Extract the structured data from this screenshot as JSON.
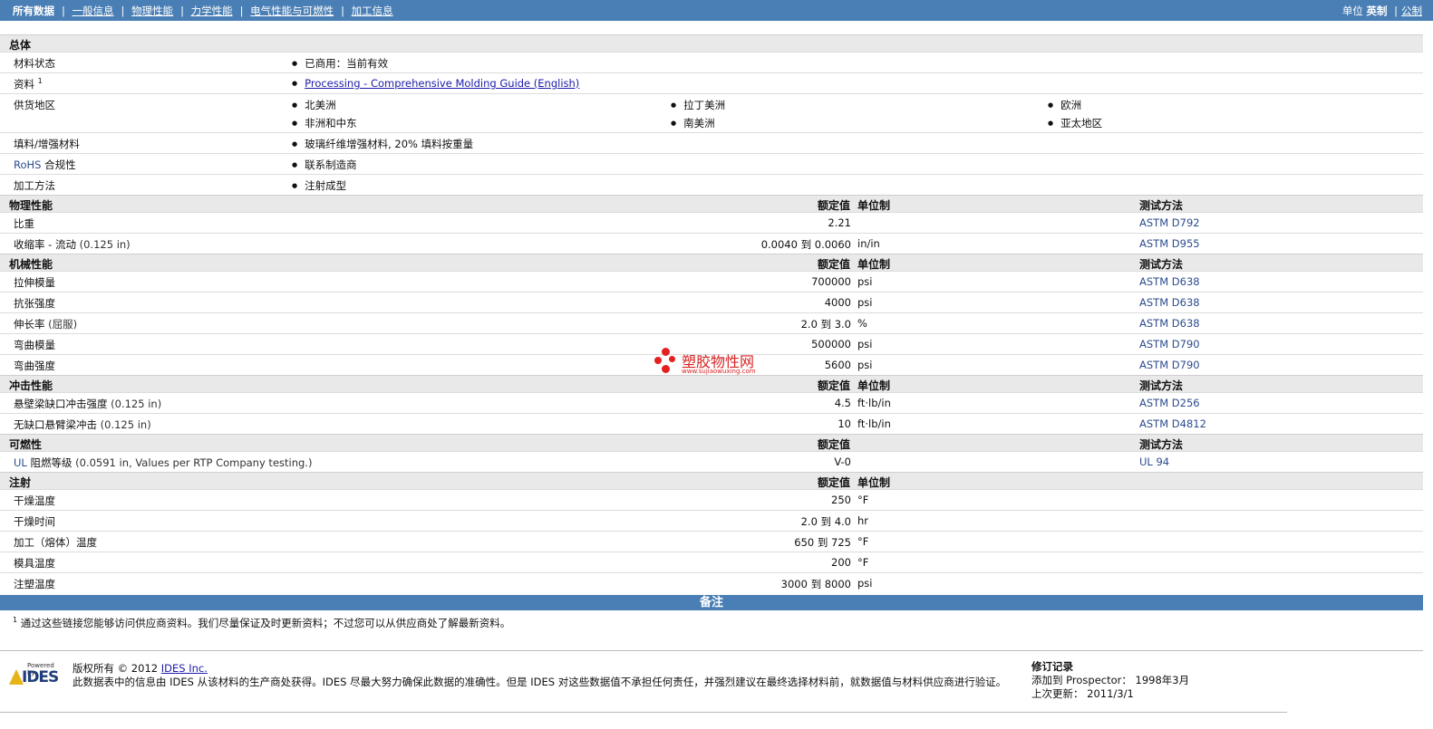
{
  "nav": {
    "items": [
      "所有数据",
      "一般信息",
      "物理性能",
      "力学性能",
      "电气性能与可燃性",
      "加工信息"
    ],
    "units_label": "单位",
    "units_selected": "英制",
    "units_other": "公制"
  },
  "general": {
    "title": "总体",
    "rows": [
      {
        "label": "材料状态",
        "values": [
          "已商用：当前有效"
        ]
      },
      {
        "label": "资料",
        "sup": "1",
        "link": "Processing - Comprehensive Molding Guide (English)"
      },
      {
        "label": "供货地区",
        "values": [
          "北美洲",
          "拉丁美洲",
          "欧洲",
          "非洲和中东",
          "南美洲",
          "亚太地区"
        ]
      },
      {
        "label": "填料/增强材料",
        "values": [
          "玻璃纤维增强材料, 20% 填料按重量"
        ]
      },
      {
        "label_prefix": "RoHS",
        "label": "合规性",
        "values": [
          "联系制造商"
        ]
      },
      {
        "label": "加工方法",
        "values": [
          "注射成型"
        ]
      }
    ]
  },
  "headers": {
    "nominal": "额定值",
    "unit": "单位制",
    "test": "测试方法"
  },
  "physical": {
    "title": "物理性能",
    "rows": [
      {
        "label": "比重",
        "value": "2.21",
        "unit": "",
        "test": "ASTM D792"
      },
      {
        "label": "收缩率 - 流动",
        "cond": "(0.125 in)",
        "value": "0.0040 到  0.0060",
        "unit": "in/in",
        "test": "ASTM D955"
      }
    ]
  },
  "mechanical": {
    "title": "机械性能",
    "rows": [
      {
        "label": "拉伸模量",
        "value": "700000",
        "unit": "psi",
        "test": "ASTM D638"
      },
      {
        "label": "抗张强度",
        "value": "4000",
        "unit": "psi",
        "test": "ASTM D638"
      },
      {
        "label": "伸长率",
        "cond": "(屈服)",
        "value": "2.0 到  3.0",
        "unit": "%",
        "test": "ASTM D638"
      },
      {
        "label": "弯曲模量",
        "value": "500000",
        "unit": "psi",
        "test": "ASTM D790"
      },
      {
        "label": "弯曲强度",
        "value": "5600",
        "unit": "psi",
        "test": "ASTM D790"
      }
    ]
  },
  "impact": {
    "title": "冲击性能",
    "rows": [
      {
        "label": "悬壁梁缺口冲击强度",
        "cond": "(0.125 in)",
        "value": "4.5",
        "unit": "ft·lb/in",
        "test": "ASTM D256"
      },
      {
        "label": "无缺口悬臂梁冲击",
        "cond": "(0.125 in)",
        "value": "10",
        "unit": "ft·lb/in",
        "test": "ASTM D4812"
      }
    ]
  },
  "flammability": {
    "title": "可燃性",
    "rows": [
      {
        "label_prefix": "UL",
        "label": "阻燃等级",
        "cond": "(0.0591 in, Values per RTP Company testing.)",
        "value": "V-0",
        "unit": "",
        "test_prefix": "UL",
        "test": "94"
      }
    ]
  },
  "injection": {
    "title": "注射",
    "rows": [
      {
        "label": "干燥温度",
        "value": "250",
        "unit": "°F"
      },
      {
        "label": "干燥时间",
        "value": "2.0 到  4.0",
        "unit": "hr"
      },
      {
        "label": "加工（熔体）温度",
        "value": "650 到  725",
        "unit": "°F"
      },
      {
        "label": "模具温度",
        "value": "200",
        "unit": "°F"
      },
      {
        "label": "注塑温度",
        "value": "3000 到  8000",
        "unit": "psi"
      }
    ]
  },
  "notes": {
    "title": "备注",
    "footnote_num": "1",
    "footnote": "通过这些链接您能够访问供应商资料。我们尽量保证及时更新资料；不过您可以从供应商处了解最新资料。"
  },
  "footer": {
    "logo_powered": "Powered by",
    "logo_text": "IDES",
    "copyright_prefix": "版权所有 © 2012",
    "copyright_link": "IDES Inc.",
    "disclaimer": "此数据表中的信息由 IDES 从该材料的生产商处获得。IDES 尽最大努力确保此数据的准确性。但是 IDES 对这些数据值不承担任何责任，并强烈建议在最终选择材料前，就数据值与材料供应商进行验证。",
    "rev_title": "修订记录",
    "added_label": "添加到 Prospector：",
    "added_value": "1998年3月",
    "updated_label": "上次更新：",
    "updated_value": "2011/3/1"
  },
  "watermark": {
    "text": "塑胶物性网",
    "url": "www.sujiaowuxing.com"
  }
}
